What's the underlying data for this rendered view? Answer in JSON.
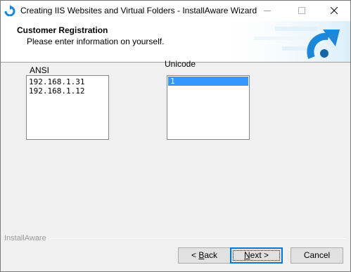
{
  "window": {
    "title": "Creating IIS Websites and Virtual Folders - InstallAware Wizard",
    "controls": {
      "minimize": "minimize-icon",
      "maximize": "maximize-icon",
      "close": "close-icon"
    }
  },
  "header": {
    "title": "Customer Registration",
    "subtitle": "Please enter information on yourself."
  },
  "main": {
    "ansi": {
      "label": "ANSI",
      "items": [
        "192.168.1.31",
        "192.168.1.12"
      ]
    },
    "unicode": {
      "label": "Unicode",
      "items": [
        "1"
      ],
      "selected_index": 0
    }
  },
  "footer": {
    "brand": "InstallAware",
    "buttons": {
      "back": {
        "prefix": "< ",
        "mnemonic": "B",
        "rest": "ack"
      },
      "next": {
        "mnemonic": "N",
        "rest": "ext >"
      },
      "cancel": "Cancel"
    }
  },
  "colors": {
    "selection": "#3399ff",
    "accent_blue": "#1e88d8",
    "window_bg": "#f0f0f0"
  }
}
